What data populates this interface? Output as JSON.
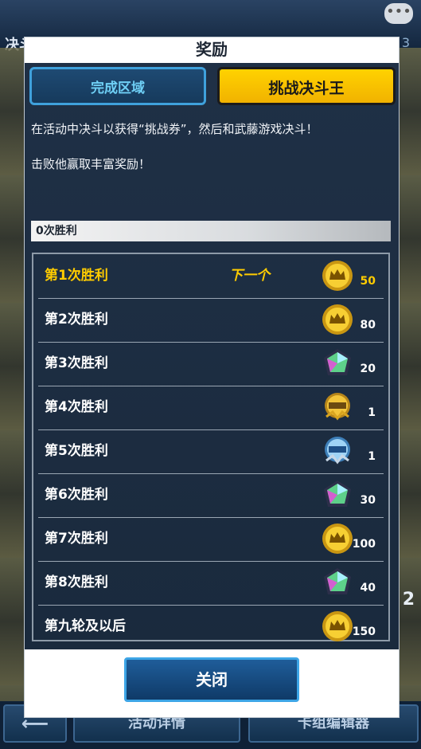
{
  "background": {
    "title": "决斗",
    "page_number": "3",
    "left_button": "活动详情",
    "right_button": "卡组编辑器",
    "side_number": "2"
  },
  "modal": {
    "title": "奖励",
    "tabs": [
      {
        "label": "完成区域",
        "active": false
      },
      {
        "label": "挑战决斗王",
        "active": true
      }
    ],
    "description_line1": "在活动中决斗以获得“挑战券”，然后和武藤游戏决斗！",
    "description_line2": "击败他赢取丰富奖励！",
    "progress_label": "0次胜利",
    "next_label": "下一个",
    "rewards": [
      {
        "label": "第1次胜利",
        "icon": "gold-coin-icon",
        "quantity": "50",
        "next": true
      },
      {
        "label": "第2次胜利",
        "icon": "gold-coin-icon",
        "quantity": "80",
        "next": false
      },
      {
        "label": "第3次胜利",
        "icon": "crystal-gem-icon",
        "quantity": "20",
        "next": false
      },
      {
        "label": "第4次胜利",
        "icon": "rare-ticket-icon",
        "quantity": "1",
        "next": false
      },
      {
        "label": "第5次胜利",
        "icon": "super-rare-ticket-icon",
        "quantity": "1",
        "next": false
      },
      {
        "label": "第6次胜利",
        "icon": "crystal-gem-icon",
        "quantity": "30",
        "next": false
      },
      {
        "label": "第7次胜利",
        "icon": "gold-coin-icon",
        "quantity": "100",
        "next": false
      },
      {
        "label": "第8次胜利",
        "icon": "crystal-gem-icon",
        "quantity": "40",
        "next": false
      },
      {
        "label": "第九轮及以后",
        "icon": "gold-coin-icon",
        "quantity": "150",
        "next": false
      }
    ],
    "close_label": "关闭"
  },
  "colors": {
    "accent_yellow": "#ffcc00",
    "tab_active_bg": "#ffd200",
    "tab_inactive_text": "#6fd0f6",
    "panel_bg": "#1f3046"
  }
}
